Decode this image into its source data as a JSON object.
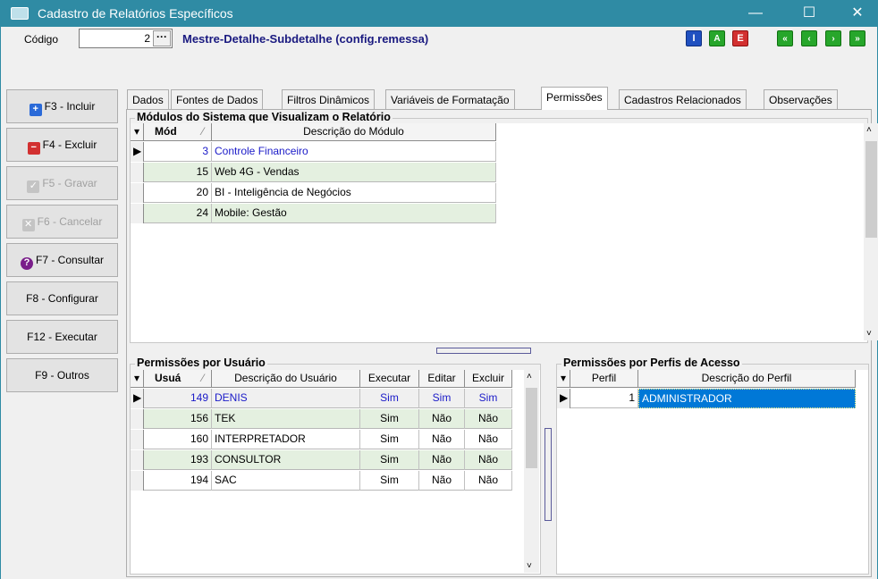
{
  "window": {
    "title": "Cadastro de Relatórios Específicos",
    "minimize": "—",
    "maximize": "☐",
    "close": "✕"
  },
  "header": {
    "codigo_label": "Código",
    "codigo_value": "2",
    "lookup_button": "···",
    "report_name": "Mestre-Detalhe-Subdetalhe (config.remessa)",
    "letter_buttons": [
      "I",
      "A",
      "E"
    ],
    "nav_buttons": [
      "«",
      "‹",
      "›",
      "»"
    ]
  },
  "sidebar": [
    {
      "label": "F3 - Incluir",
      "icon": "+",
      "icon_color": "#2a6ad8",
      "enabled": true
    },
    {
      "label": "F4 - Excluir",
      "icon": "−",
      "icon_color": "#d23030",
      "enabled": true
    },
    {
      "label": "F5 - Gravar",
      "icon": "✓",
      "icon_color": "#b0b0b0",
      "enabled": false
    },
    {
      "label": "F6 - Cancelar",
      "icon": "✕",
      "icon_color": "#b0b0b0",
      "enabled": false
    },
    {
      "label": "F7 - Consultar",
      "icon": "?",
      "icon_color": "#7a1e8a",
      "enabled": true
    },
    {
      "label": "F8 - Configurar",
      "icon": "",
      "icon_color": "",
      "enabled": true
    },
    {
      "label": "F12 - Executar",
      "icon": "",
      "icon_color": "",
      "enabled": true
    },
    {
      "label": "F9 - Outros",
      "icon": "",
      "icon_color": "",
      "enabled": true
    }
  ],
  "tabs": [
    "Dados",
    "Fontes de Dados",
    "Filtros Dinâmicos",
    "Variáveis de Formatação",
    "Permissões",
    "Cadastros Relacionados",
    "Observações"
  ],
  "active_tab": "Permissões",
  "modulos": {
    "title": "Módulos do Sistema que Visualizam o Relatório",
    "columns": [
      "Mód",
      "Descrição do Módulo"
    ],
    "rows": [
      {
        "mod": "3",
        "desc": "Controle Financeiro"
      },
      {
        "mod": "15",
        "desc": "Web 4G - Vendas"
      },
      {
        "mod": "20",
        "desc": "BI - Inteligência de Negócios"
      },
      {
        "mod": "24",
        "desc": "Mobile: Gestão"
      }
    ]
  },
  "usuarios": {
    "title": "Permissões por Usuário",
    "columns": [
      "Usuá",
      "Descrição do Usuário",
      "Executar",
      "Editar",
      "Excluir"
    ],
    "rows": [
      {
        "id": "149",
        "desc": "DENIS",
        "executar": "Sim",
        "editar": "Sim",
        "excluir": "Sim"
      },
      {
        "id": "156",
        "desc": "TEK",
        "executar": "Sim",
        "editar": "Não",
        "excluir": "Não"
      },
      {
        "id": "160",
        "desc": "INTERPRETADOR",
        "executar": "Sim",
        "editar": "Não",
        "excluir": "Não"
      },
      {
        "id": "193",
        "desc": "CONSULTOR",
        "executar": "Sim",
        "editar": "Não",
        "excluir": "Não"
      },
      {
        "id": "194",
        "desc": "SAC",
        "executar": "Sim",
        "editar": "Não",
        "excluir": "Não"
      }
    ]
  },
  "perfis": {
    "title": "Permissões por Perfis de Acesso",
    "columns": [
      "Perfil",
      "Descrição do Perfil"
    ],
    "rows": [
      {
        "id": "1",
        "desc": "ADMINISTRADOR"
      }
    ]
  }
}
